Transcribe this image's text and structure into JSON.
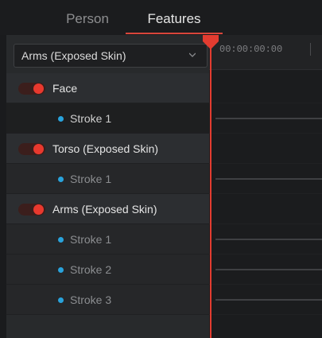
{
  "tabs": [
    {
      "label": "Person",
      "active": false
    },
    {
      "label": "Features",
      "active": true
    }
  ],
  "feature_selector": {
    "selected": "Arms (Exposed Skin)"
  },
  "feature_list": [
    {
      "type": "group",
      "label": "Face",
      "enabled": true
    },
    {
      "type": "stroke",
      "label": "Stroke 1",
      "selected": true
    },
    {
      "type": "group",
      "label": "Torso (Exposed Skin)",
      "enabled": true
    },
    {
      "type": "stroke",
      "label": "Stroke 1",
      "selected": false
    },
    {
      "type": "group",
      "label": "Arms (Exposed Skin)",
      "enabled": true
    },
    {
      "type": "stroke",
      "label": "Stroke 1",
      "selected": false
    },
    {
      "type": "stroke",
      "label": "Stroke 2",
      "selected": false
    },
    {
      "type": "stroke",
      "label": "Stroke 3",
      "selected": false
    }
  ],
  "timeline": {
    "timecode": "00:00:00:00"
  },
  "colors": {
    "accent": "#e33c30",
    "stroke_dot": "#29a3dc",
    "panel": "#282a2c",
    "background": "#1a1b1d"
  }
}
